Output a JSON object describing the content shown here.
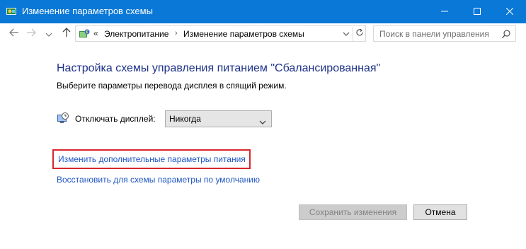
{
  "window": {
    "title": "Изменение параметров схемы",
    "accent": "#0a78d7"
  },
  "nav": {
    "back_icon": "arrow-left-icon",
    "forward_icon": "arrow-right-icon",
    "recent_icon": "chevron-down-icon",
    "up_icon": "arrow-up-icon"
  },
  "address": {
    "overflow": "«",
    "crumbs": [
      "Электропитание",
      "Изменение параметров схемы"
    ],
    "separator": "›"
  },
  "search": {
    "placeholder": "Поиск в панели управления"
  },
  "main": {
    "heading": "Настройка схемы управления питанием \"Сбалансированная\"",
    "subtitle": "Выберите параметры перевода дисплея в спящий режим.",
    "display_off_label": "Отключать дисплей:",
    "display_off_value": "Никогда",
    "advanced_link": "Изменить дополнительные параметры питания",
    "restore_link": "Восстановить для схемы параметры по умолчанию",
    "link_color": "#1f56c4",
    "heading_color": "#1e3287",
    "highlight_color": "#d8262c"
  },
  "buttons": {
    "save": "Сохранить изменения",
    "cancel": "Отмена"
  }
}
